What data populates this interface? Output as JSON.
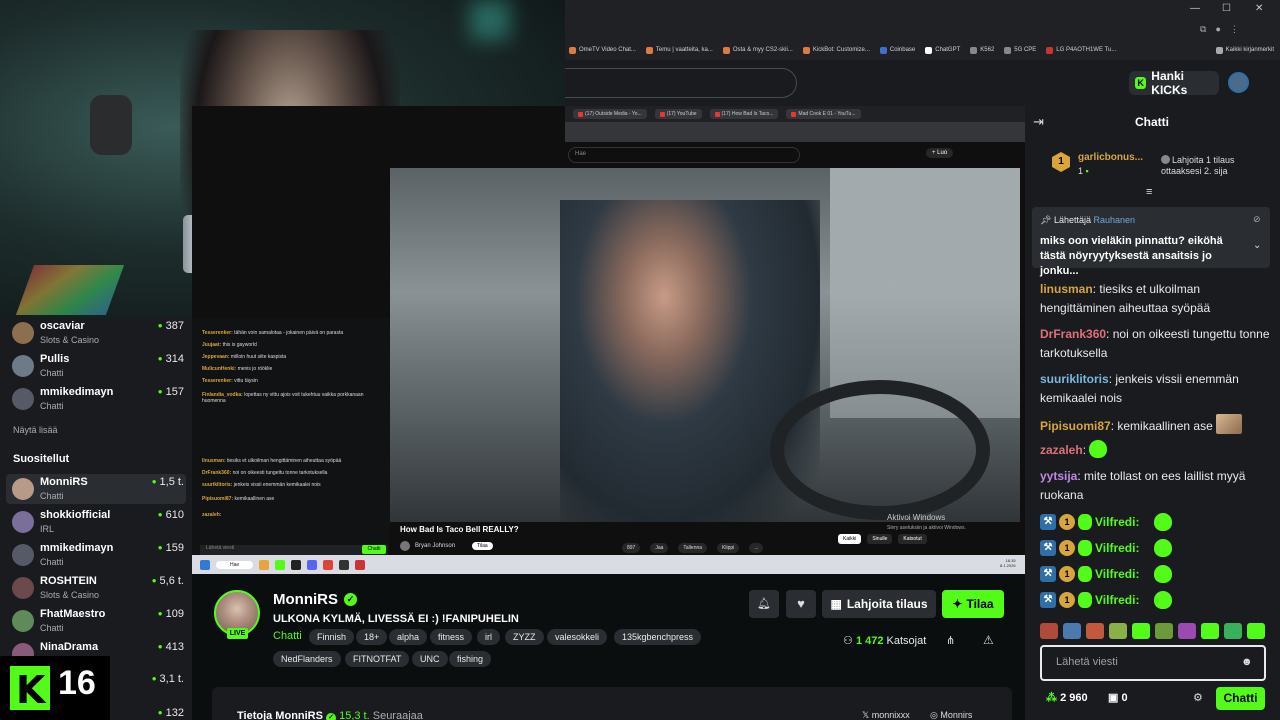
{
  "bookmarks": [
    "OmeTV Video Chat...",
    "Temu | vaatteita, ka...",
    "Osta & myy CS2-skii...",
    "KickBot: Customize...",
    "Coinbase",
    "ChatGPT",
    "K562",
    "5G CPE",
    "LG P4AOTH1WE Tu...",
    "Kaikki kirjanmerkit"
  ],
  "kicknav": {
    "hanki_label": "Hanki KICKs"
  },
  "sidebar": {
    "top_channels": [
      {
        "name": "oscaviar",
        "category": "Slots & Casino",
        "viewers": "387",
        "color": "#8b6f4e"
      },
      {
        "name": "Pullis",
        "category": "Chatti",
        "viewers": "314",
        "color": "#6d7a88"
      },
      {
        "name": "mmikedimayn",
        "category": "Chatti",
        "viewers": "157",
        "color": "#555a66"
      }
    ],
    "show_more": "Näytä lisää",
    "recommended_title": "Suositellut",
    "recommended": [
      {
        "name": "MonniRS",
        "category": "Chatti",
        "viewers": "1,5 t.",
        "color": "#b89a88"
      },
      {
        "name": "shokkiofficial",
        "category": "IRL",
        "viewers": "610",
        "color": "#7a6f9a"
      },
      {
        "name": "mmikedimayn",
        "category": "Chatti",
        "viewers": "159",
        "color": "#555a66"
      },
      {
        "name": "ROSHTEIN",
        "category": "Slots & Casino",
        "viewers": "5,6 t.",
        "color": "#6a4a4a"
      },
      {
        "name": "FhatMaestro",
        "category": "Chatti",
        "viewers": "109",
        "color": "#5f8a5a"
      },
      {
        "name": "NinaDrama",
        "category": "",
        "viewers": "413",
        "color": "#8a5a7a"
      }
    ],
    "extra_viewers": [
      "3,1 t.",
      "132"
    ]
  },
  "kick16": {
    "number": "16"
  },
  "screen": {
    "tabs": [
      "(17) Outside Media - Yo...",
      "(17) YouTube",
      "(17) How Bad Is Taco...",
      "Mad Cook E 01 - YouTu..."
    ],
    "yt_search_placeholder": "Hae",
    "yt_login": "+ Luo",
    "minichat_lines": [
      {
        "user": "Tesserenker:",
        "text": "tähän voin samalotaa - jokainen päivä on parasta"
      },
      {
        "user": "Juujaat:",
        "text": "this is gayworld"
      },
      {
        "user": "Jeppevaan:",
        "text": "milloin huut siite kaspista"
      },
      {
        "user": "MulicunHenki:",
        "text": "menis jo rööklie"
      },
      {
        "user": "Tesserenker:",
        "text": "vittu täysin"
      },
      {
        "user": "Finlandia_vodka:",
        "text": "lopettas ny vittu ajois voit tukehtuu vaikka porkkanaan huomenna"
      },
      {
        "user": "linusman:",
        "text": "tiesiks et ulkoilman hengittäminen aiheuttaa syöpää"
      },
      {
        "user": "DrFrank360:",
        "text": "noi on oikeesti tungettu tonne tarkotuksella"
      },
      {
        "user": "suuriklitoris:",
        "text": "jenkeis vissii enemmän kemikaalei nois"
      },
      {
        "user": "Pipisuomi87:",
        "text": "kemikaallinen ase"
      },
      {
        "user": "zazaleh:",
        "text": ""
      }
    ],
    "minichat_input": "Lähetä viesti",
    "minichat_send": "Chatti",
    "video_title": "How Bad Is Taco Bell REALLY?",
    "video_channel": "Bryan Johnson",
    "video_subscribe": "Tilaa",
    "video_actions": [
      "897",
      "Jaa",
      "Tallenna",
      "Klippi",
      "..."
    ],
    "watermark_title": "Aktivoi Windows",
    "watermark_sub": "Siirry asetuksiin ja aktivoi Windows.",
    "chips": [
      "Kaikki",
      "Sinulle",
      "Katsotut"
    ],
    "taskbar_search": "Hae",
    "clock_time": "18.35",
    "clock_date": "8.1.2026"
  },
  "stream": {
    "name": "MonniRS",
    "live": "LIVE",
    "title": "ULKONA KYLMÄ, LIVESSÄ EI :) !FANIPUHELIN",
    "category": "Chatti",
    "tags_row1": [
      "Finnish",
      "18+",
      "alpha",
      "fitness",
      "irl",
      "ZYZZ",
      "valesokkeli",
      "135kgbenchpress"
    ],
    "tags_row2": [
      "NedFlanders",
      "FITNOTFAT",
      "UNC",
      "fishing"
    ],
    "gift_label": "Lahjoita tilaus",
    "subscribe_label": "Tilaa",
    "viewers": "1 472",
    "viewers_label": "Katsojat",
    "about_title": "Tietoja MonniRS",
    "followers": "15,3 t.",
    "followers_label": "Seuraajaa",
    "social_x": "monnixxx",
    "social_ig": "Monnirs"
  },
  "chat": {
    "title": "Chatti",
    "leader_rank": "1",
    "leader_name": "garlicbonus...",
    "leader_count": "1",
    "gift_prompt": "Lahjoita 1 tilaus ottaaksesi 2. sija",
    "pinned_by_label": "Lähettäjä",
    "pinned_by_user": "Rauhanen",
    "pinned_message": "miks oon vieläkin pinnattu? eiköhä tästä nöyryytyksestä ansaitsis jo jonku...",
    "messages": [
      {
        "user": "linusman",
        "color": "#d8a53d",
        "text": "tiesiks et ulkoilman hengittäminen aiheuttaa syöpää"
      },
      {
        "user": "DrFrank360",
        "color": "#e0707a",
        "text": "noi on oikeesti tungettu tonne tarkotuksella"
      },
      {
        "user": "suuriklitoris",
        "color": "#7ab8e0",
        "text": "jenkeis vissii enemmän kemikaalei nois"
      },
      {
        "user": "Pipisuomi87",
        "color": "#d8a53d",
        "text": "kemikaallinen ase"
      },
      {
        "user": "zazaleh",
        "color": "#e0707a",
        "text": ""
      },
      {
        "user": "yytsija",
        "color": "#c08ae0",
        "text": "mite tollast on ees laillist myyä ruokana"
      }
    ],
    "repeat_user": "Vilfredi:",
    "repeat_badge": "1",
    "input_placeholder": "Lähetä viesti",
    "points": "2 960",
    "kicks": "0",
    "send_label": "Chatti"
  }
}
